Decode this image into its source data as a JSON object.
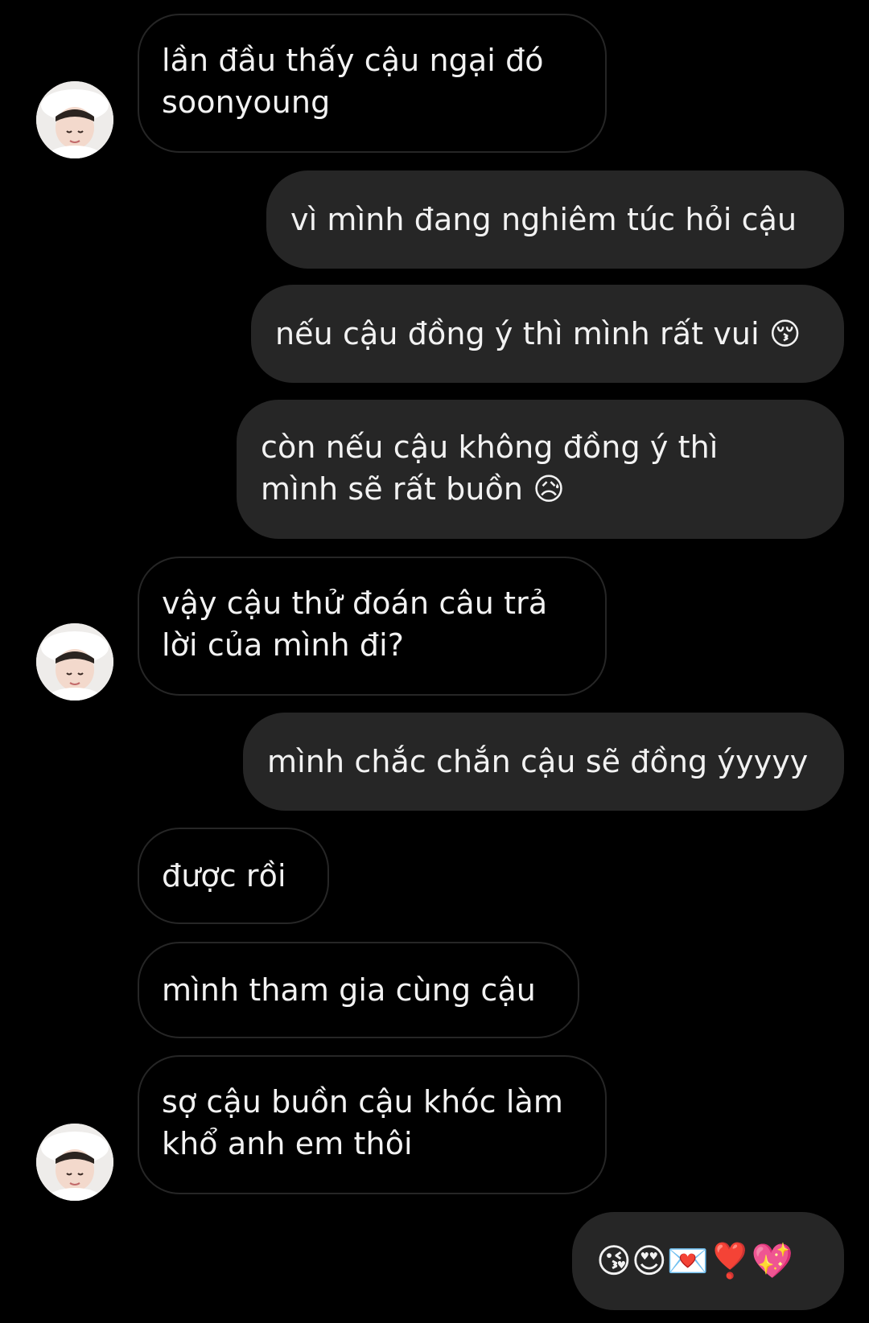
{
  "conversation": {
    "messages": [
      {
        "side": "in",
        "lines": [
          "lần đầu thấy cậu ngại đó",
          "soonyoung"
        ]
      },
      {
        "side": "out",
        "lines": [
          "vì mình đang nghiêm túc hỏi cậu"
        ]
      },
      {
        "side": "out",
        "lines": [
          "nếu cậu đồng ý thì mình rất vui 😚"
        ]
      },
      {
        "side": "out",
        "lines": [
          "còn nếu cậu không đồng ý thì",
          "mình sẽ rất buồn 😥"
        ]
      },
      {
        "side": "in",
        "lines": [
          "vậy cậu thử đoán câu trả",
          "lời của mình đi?"
        ]
      },
      {
        "side": "out",
        "lines": [
          "mình chắc chắn cậu sẽ đồng ýyyyy"
        ]
      },
      {
        "side": "in",
        "lines": [
          "được rồi"
        ]
      },
      {
        "side": "in",
        "lines": [
          "mình tham gia cùng cậu"
        ]
      },
      {
        "side": "in",
        "lines": [
          "sợ cậu buồn cậu khóc làm",
          "khổ anh em thôi"
        ]
      },
      {
        "side": "out",
        "lines": [
          "😘😍💌❣️💖"
        ]
      }
    ]
  },
  "theme": {
    "background": "#000000",
    "outgoing_bubble": "#262626",
    "incoming_border": "#262626",
    "text": "#f2f2f2"
  },
  "icons": {
    "avatar": "profile-avatar"
  }
}
